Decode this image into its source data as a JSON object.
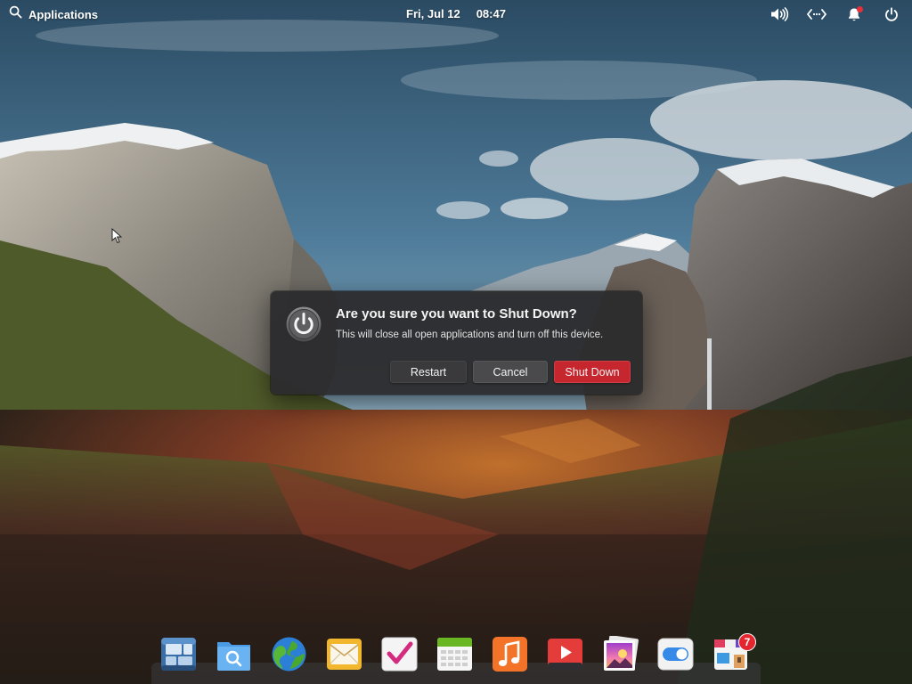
{
  "panel": {
    "applications_label": "Applications",
    "date": "Fri, Jul 12",
    "time": "08:47",
    "indicators": [
      "volume-icon",
      "network-icon",
      "notifications-icon",
      "power-icon"
    ]
  },
  "dialog": {
    "title": "Are you sure you want to Shut Down?",
    "body": "This will close all open applications and turn off this device.",
    "restart_label": "Restart",
    "cancel_label": "Cancel",
    "shutdown_label": "Shut Down",
    "shutdown_color": "#c6262e"
  },
  "dock": {
    "items": [
      {
        "icon": "multitasking-view-icon"
      },
      {
        "icon": "files-icon"
      },
      {
        "icon": "web-browser-icon"
      },
      {
        "icon": "mail-icon"
      },
      {
        "icon": "tasks-icon"
      },
      {
        "icon": "calendar-icon"
      },
      {
        "icon": "music-icon"
      },
      {
        "icon": "videos-icon"
      },
      {
        "icon": "photos-icon"
      },
      {
        "icon": "system-settings-icon"
      },
      {
        "icon": "appcenter-icon",
        "badge": "7"
      }
    ]
  }
}
